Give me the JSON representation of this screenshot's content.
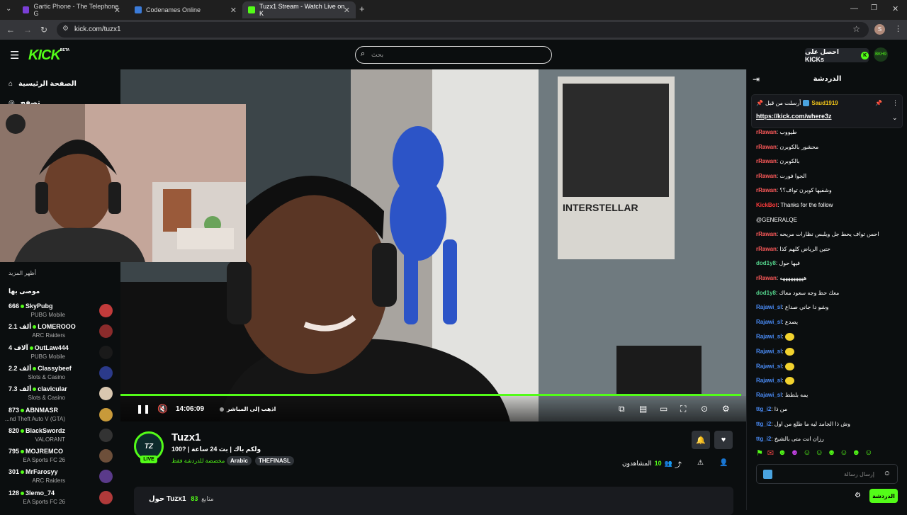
{
  "browser": {
    "tabs": [
      {
        "title": "Gartic Phone - The Telephone G",
        "color": "#7a3fd6"
      },
      {
        "title": "Codenames Online",
        "color": "#3b7bd8"
      },
      {
        "title": "Tuzx1 Stream - Watch Live on K",
        "color": "#53fc18"
      }
    ],
    "new_tab": "+",
    "url": "kick.com/tuzx1",
    "profile_initial": "S"
  },
  "header": {
    "logo": "KICK",
    "logo_badge": "BETA",
    "search_placeholder": "بحث",
    "get_kicks_label": "احصل على KICKs",
    "user_avatar": "BKH9"
  },
  "sidebar": {
    "home_label": "الصفحة الرئيسية",
    "browse_label": "تصفح",
    "show_more": "أظهر المزيد",
    "recommended_title": "موصى بها",
    "channels": [
      {
        "count": "666",
        "name": "SkyPubg",
        "category": "PUBG Mobile",
        "avatar_color": "#c23b3b"
      },
      {
        "count": "2.1 ألف",
        "name": "LOMEROOO",
        "category": "ARC Raiders",
        "avatar_color": "#8a2b2b"
      },
      {
        "count": "4 آلاف",
        "name": "OutLaw444",
        "category": "PUBG Mobile",
        "avatar_color": "#1a1a1a"
      },
      {
        "count": "2.2 ألف",
        "name": "Classybeef",
        "category": "Slots & Casino",
        "avatar_color": "#2b3a8a"
      },
      {
        "count": "7.3 ألف",
        "name": "clavicular",
        "category": "Slots & Casino",
        "avatar_color": "#d9c7b0"
      },
      {
        "count": "873",
        "name": "ABNMASR",
        "category": "...nd Theft Auto V (GTA)",
        "avatar_color": "#c89a3a"
      },
      {
        "count": "820",
        "name": "BlackSwordz",
        "category": "VALORANT",
        "avatar_color": "#333333"
      },
      {
        "count": "795",
        "name": "MOJREMCO",
        "category": "EA Sports FC 26",
        "avatar_color": "#6d4f3a"
      },
      {
        "count": "301",
        "name": "MrFarosyy",
        "category": "ARC Raiders",
        "avatar_color": "#5a3a8a"
      },
      {
        "count": "128",
        "name": "3lemo_74",
        "category": "EA Sports FC 26",
        "avatar_color": "#b03a3a"
      }
    ]
  },
  "player": {
    "timecode": "14:06:09",
    "go_live": "اذهب إلى المباشر",
    "progress": 0.992
  },
  "stream": {
    "streamer": "Tuzx1",
    "avatar_text": "TZ",
    "live_badge": "LIVE",
    "title": "ولكم باك | بث 24 ساعة | ?100",
    "category": "مخصصة للدردشة فقط",
    "tags": [
      "Arabic",
      "THEFINASL"
    ],
    "viewers_label": "المشاهدون",
    "viewers_count": "10",
    "about_title": "حول Tuzx1",
    "followers_count": "83",
    "followers_label": "متابع"
  },
  "chat": {
    "title": "الدردشة",
    "pinned": {
      "user": "Saud1919",
      "label": "أرسلت من قبل",
      "link": "https://kick.com/where3z"
    },
    "messages": [
      {
        "user": "rRawan",
        "color": "#ff5a5a",
        "text": "طيووب"
      },
      {
        "user": "rRawan",
        "color": "#ff5a5a",
        "text": "محشور بالكوبرن"
      },
      {
        "user": "rRawan",
        "color": "#ff5a5a",
        "text": "بالكوبرن"
      },
      {
        "user": "rRawan",
        "color": "#ff5a5a",
        "text": "الجوا فورت"
      },
      {
        "user": "rRawan",
        "color": "#ff5a5a",
        "text": "وشفيها كوبرن تواف؟؟"
      },
      {
        "user": "KickBot",
        "color": "#ff3b3b",
        "text": "Thanks for the follow"
      },
      {
        "user": "",
        "color": "#ffffff",
        "text": "@GENERALQE"
      },
      {
        "user": "rRawan",
        "color": "#ff5a5a",
        "text": "احس تواف يحط جل ويلبس نظارات مريحه"
      },
      {
        "user": "rRawan",
        "color": "#ff5a5a",
        "text": "حتين الرياض كلهم كذا"
      },
      {
        "user": "dod1y8",
        "color": "#53d18a",
        "text": "فيها حول"
      },
      {
        "user": "rRawan",
        "color": "#ff5a5a",
        "text": "هههههههههه"
      },
      {
        "user": "dod1y8",
        "color": "#53d18a",
        "text": "معك حظ وجه سعود معاك"
      },
      {
        "user": "Rajawi_sl",
        "color": "#4a8cf7",
        "text": "وشو دا جاني صداع"
      },
      {
        "user": "Rajawi_sl",
        "color": "#4a8cf7",
        "text": "يصدع"
      },
      {
        "user": "Rajawi_sl",
        "color": "#4a8cf7",
        "text": ""
      },
      {
        "user": "Rajawi_sl",
        "color": "#4a8cf7",
        "text": ""
      },
      {
        "user": "Rajawi_sl",
        "color": "#4a8cf7",
        "text": ""
      },
      {
        "user": "Rajawi_sl",
        "color": "#4a8cf7",
        "text": ""
      },
      {
        "user": "Rajawi_sl",
        "color": "#4a8cf7",
        "text": "يمه بلطط"
      },
      {
        "user": "ttg_i2",
        "color": "#4a8cf7",
        "text": "من ذا"
      },
      {
        "user": "ttg_i2",
        "color": "#4a8cf7",
        "text": "وش ذا الجامد ليه ما طلع من اول"
      },
      {
        "user": "ttg_i2",
        "color": "#4a8cf7",
        "text": "رزان انت متى بالشيخ"
      }
    ],
    "input_placeholder": "إرسال رسالة",
    "send_label": "الدردشة"
  }
}
